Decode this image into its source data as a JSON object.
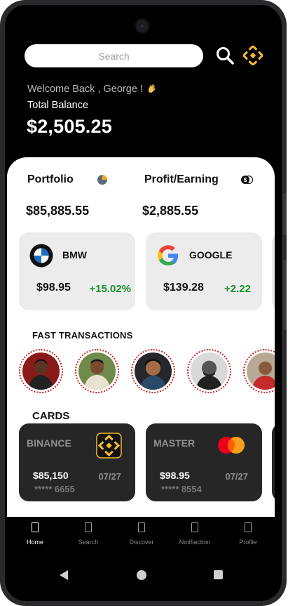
{
  "header": {
    "search_placeholder": "Search",
    "welcome": "Welcome Back , George !",
    "balance_label": "Total Balance",
    "balance_amount": "$2,505.25"
  },
  "summary": {
    "portfolio_label": "Portfolio",
    "portfolio_value": "$85,885.55",
    "profit_label": "Profit/Earning",
    "profit_value": "$2,885.55"
  },
  "stocks": [
    {
      "name": "BMW",
      "price": "$98.95",
      "change": "+15.02%",
      "icon": "bmw-logo-icon"
    },
    {
      "name": "GOOGLE",
      "price": "$139.28",
      "change": "+2.22",
      "icon": "google-logo-icon"
    }
  ],
  "fast_transactions": {
    "title": "FAST TRANSACTIONS",
    "contacts": [
      {
        "icon": "contact-avatar-1"
      },
      {
        "icon": "contact-avatar-2"
      },
      {
        "icon": "contact-avatar-3"
      },
      {
        "icon": "contact-avatar-4"
      },
      {
        "icon": "contact-avatar-5"
      }
    ]
  },
  "cards": {
    "title": "CARDS",
    "items": [
      {
        "name": "BINANCE",
        "amount": "$85,150",
        "expiry": "07/27",
        "number": "***** 6655",
        "icon": "binance-logo-icon"
      },
      {
        "name": "MASTER",
        "amount": "$98.95",
        "expiry": "07/27",
        "number": "***** 8554",
        "icon": "mastercard-logo-icon"
      }
    ]
  },
  "nav": {
    "items": [
      {
        "label": "Home",
        "active": true
      },
      {
        "label": "Search",
        "active": false
      },
      {
        "label": "Discover",
        "active": false
      },
      {
        "label": "Notifiaction",
        "active": false
      },
      {
        "label": "Profile",
        "active": false
      }
    ]
  },
  "colors": {
    "accent": "#f3ba2f",
    "positive": "#1b8f2b",
    "ring": "#d61f1f",
    "card_dark": "#262626"
  }
}
